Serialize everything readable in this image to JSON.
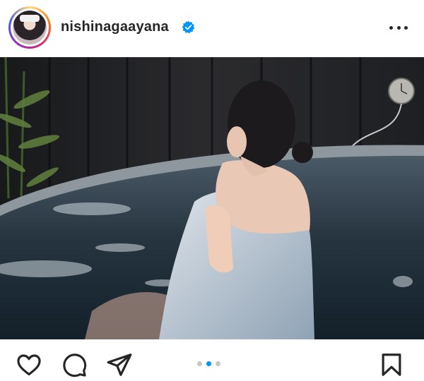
{
  "post": {
    "username": "nishinagaayana",
    "verified": true,
    "carousel": {
      "count": 3,
      "active_index": 1
    }
  },
  "icons": {
    "header": [
      "avatar",
      "verified-badge-icon",
      "more-options-icon"
    ],
    "actions": [
      "like-icon",
      "comment-icon",
      "share-icon",
      "save-icon"
    ]
  },
  "colors": {
    "verified": "#0095f6",
    "active_dot": "#0095f6",
    "inactive_dot": "#c7c7c7",
    "text": "#262626"
  }
}
